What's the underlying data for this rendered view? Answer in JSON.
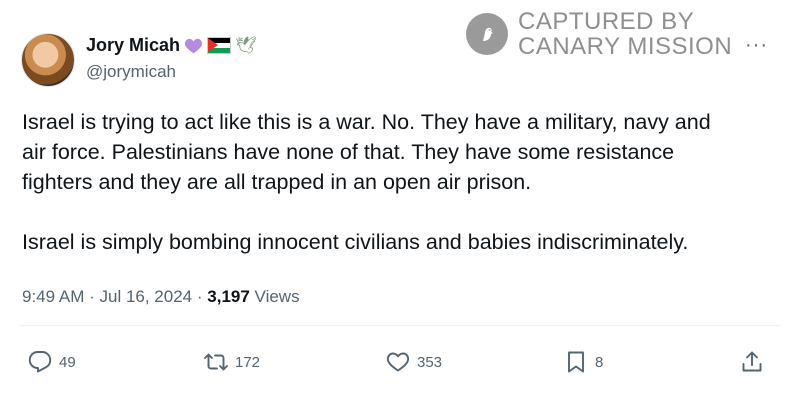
{
  "author": {
    "name": "Jory Micah",
    "handle": "@jorymicah",
    "name_emojis": [
      "purple-heart",
      "palestine-flag",
      "dove"
    ]
  },
  "watermark": {
    "line1": "CAPTURED BY",
    "line2": "CANARY MISSION"
  },
  "more_menu": "···",
  "tweet": {
    "text": "Israel is trying to act like this is a war. No. They have a military, navy and\nair force. Palestinians have none of that. They have some resistance\nfighters and they are all trapped in an open air prison.\n\nIsrael is simply bombing innocent civilians and babies indiscriminately.",
    "time": "9:49 AM",
    "date": "Jul 16, 2024",
    "views_count": "3,197",
    "views_label": "Views"
  },
  "actions": {
    "replies": "49",
    "reposts": "172",
    "likes": "353",
    "bookmarks": "8"
  },
  "colors": {
    "text_primary": "#0f1419",
    "text_secondary": "#536471",
    "watermark_gray": "#8f8f8f"
  }
}
